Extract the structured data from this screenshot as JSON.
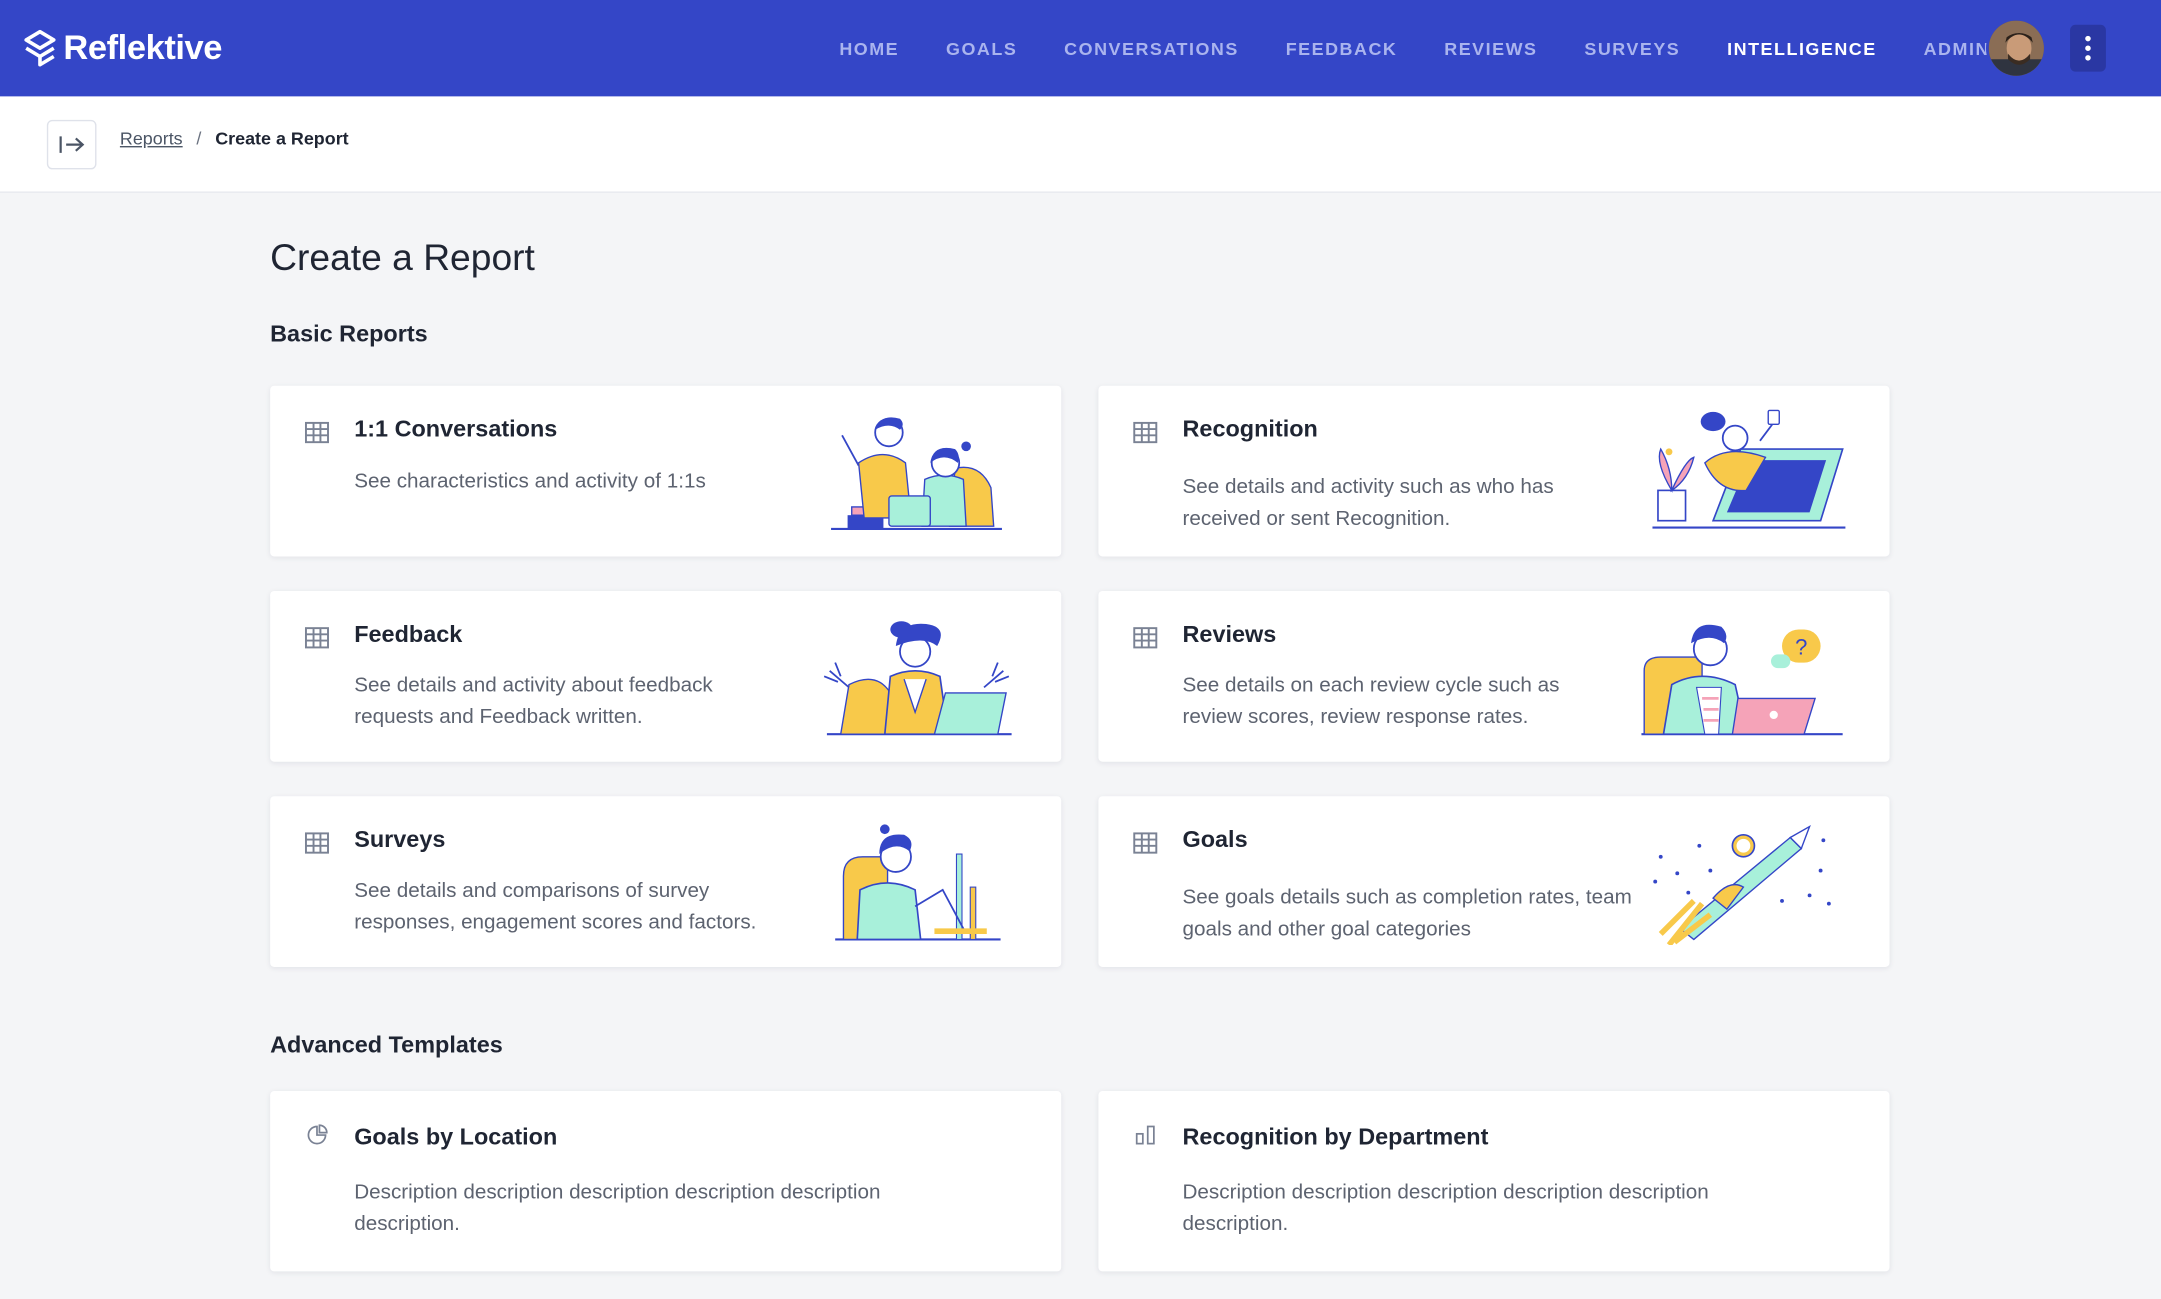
{
  "app": {
    "brand": "Reflektive"
  },
  "nav": {
    "items": [
      {
        "label": "HOME",
        "active": false
      },
      {
        "label": "GOALS",
        "active": false
      },
      {
        "label": "CONVERSATIONS",
        "active": false
      },
      {
        "label": "FEEDBACK",
        "active": false
      },
      {
        "label": "REVIEWS",
        "active": false
      },
      {
        "label": "SURVEYS",
        "active": false
      },
      {
        "label": "INTELLIGENCE",
        "active": true
      },
      {
        "label": "ADMIN",
        "active": false
      }
    ]
  },
  "breadcrumb": {
    "parent": "Reports",
    "separator": "/",
    "current": "Create a Report"
  },
  "page": {
    "title": "Create a Report"
  },
  "basic": {
    "title": "Basic Reports",
    "cards": [
      {
        "title": "1:1 Conversations",
        "desc": "See characteristics and activity of 1:1s",
        "icon": "table-icon"
      },
      {
        "title": "Recognition",
        "desc": "See details and activity such as who has received or sent Recognition.",
        "icon": "table-icon"
      },
      {
        "title": "Feedback",
        "desc": "See details and activity about feedback requests and Feedback written.",
        "icon": "table-icon"
      },
      {
        "title": "Reviews",
        "desc": "See details on each review cycle such as review scores, review response rates.",
        "icon": "table-icon"
      },
      {
        "title": "Surveys",
        "desc": "See details and comparisons of survey responses, engagement scores and factors.",
        "icon": "table-icon"
      },
      {
        "title": "Goals",
        "desc": "See goals details such as completion rates, team goals and other goal categories",
        "icon": "table-icon"
      }
    ]
  },
  "advanced": {
    "title": "Advanced Templates",
    "cards": [
      {
        "title": "Goals by Location",
        "desc": "Description description description description description description.",
        "icon": "pie-chart-icon"
      },
      {
        "title": "Recognition by Department",
        "desc": "Description description description description description description.",
        "icon": "bar-chart-icon"
      }
    ]
  },
  "colors": {
    "brand": "#3446c7",
    "accent_yellow": "#f8c94a",
    "accent_mint": "#a8f0da",
    "accent_pink": "#f5a3b8"
  }
}
